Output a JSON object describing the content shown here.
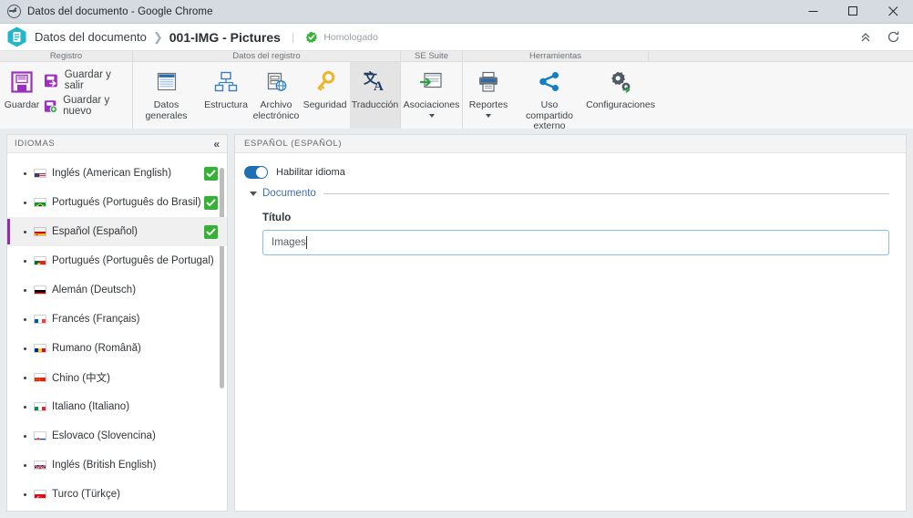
{
  "titlebar": {
    "title": "Datos del documento - Google Chrome",
    "app_icon": "chrome-icon",
    "minimize": "minimize-button",
    "maximize": "maximize-button",
    "close": "close-button"
  },
  "header": {
    "app_icon": "document-hexagon-icon",
    "breadcrumb_root": "Datos del documento",
    "breadcrumb_separator": "❯",
    "breadcrumb_current": "001-IMG - Pictures",
    "divider": "|",
    "status_badge": "Homologado",
    "status_icon": "gear-check-green-icon",
    "collapse_icon": "chevron-double-up-icon",
    "refresh_icon": "refresh-icon"
  },
  "ribbon": {
    "groups": [
      {
        "name": "Registro"
      },
      {
        "name": "Datos del registro"
      },
      {
        "name": "SE Suite"
      },
      {
        "name": "Herramientas"
      }
    ],
    "registro": {
      "save": {
        "label": "Guardar",
        "icon": "floppy-disk-icon"
      },
      "save_exit": {
        "label": "Guardar y salir",
        "icon": "save-exit-icon"
      },
      "save_new": {
        "label": "Guardar y nuevo",
        "icon": "save-new-icon"
      }
    },
    "datos_del_registro": [
      {
        "label": "Datos generales",
        "icon": "window-form-icon",
        "active": false
      },
      {
        "label": "Estructura",
        "icon": "hierarchy-icon",
        "active": false
      },
      {
        "label": "Archivo electrónico",
        "icon": "electronic-file-icon",
        "active": false
      },
      {
        "label": "Seguridad",
        "icon": "key-icon",
        "active": false
      },
      {
        "label": "Traducción",
        "icon": "translate-icon",
        "active": true
      }
    ],
    "se_suite": [
      {
        "label": "Asociaciones",
        "icon": "associations-icon",
        "dropdown": true
      }
    ],
    "herramientas": [
      {
        "label": "Reportes",
        "icon": "printer-icon",
        "dropdown": true
      },
      {
        "label": "Uso compartido externo",
        "icon": "share-icon",
        "dropdown": false
      },
      {
        "label": "Configuraciones",
        "icon": "gears-icon",
        "dropdown": false
      }
    ]
  },
  "sidebar": {
    "title": "IDIOMAS",
    "collapse_icon": "chevron-double-left-icon",
    "items": [
      {
        "label": "Inglés (American English)",
        "flag": "flag-us",
        "checked": true,
        "selected": false
      },
      {
        "label": "Portugués (Português do Brasil)",
        "flag": "flag-br",
        "checked": true,
        "selected": false
      },
      {
        "label": "Español (Español)",
        "flag": "flag-es",
        "checked": true,
        "selected": true
      },
      {
        "label": "Portugués (Português de Portugal)",
        "flag": "flag-pt",
        "checked": false,
        "selected": false
      },
      {
        "label": "Alemán (Deutsch)",
        "flag": "flag-de",
        "checked": false,
        "selected": false
      },
      {
        "label": "Francés (Français)",
        "flag": "flag-fr",
        "checked": false,
        "selected": false
      },
      {
        "label": "Rumano (Română)",
        "flag": "flag-ro",
        "checked": false,
        "selected": false
      },
      {
        "label": "Chino (中文)",
        "flag": "flag-cn",
        "checked": false,
        "selected": false
      },
      {
        "label": "Italiano (Italiano)",
        "flag": "flag-it",
        "checked": false,
        "selected": false
      },
      {
        "label": "Eslovaco (Slovencina)",
        "flag": "flag-sk",
        "checked": false,
        "selected": false
      },
      {
        "label": "Inglés (British English)",
        "flag": "flag-gb",
        "checked": false,
        "selected": false
      },
      {
        "label": "Turco (Türkçe)",
        "flag": "flag-tr",
        "checked": false,
        "selected": false
      }
    ]
  },
  "panel": {
    "title": "ESPAÑOL (ESPAÑOL)",
    "toggle": {
      "label": "Habilitar idioma",
      "on": true
    },
    "section": {
      "title": "Documento",
      "expanded": true
    },
    "field": {
      "label": "Título",
      "value": "Images",
      "placeholder": ""
    }
  },
  "colors": {
    "accent_purple": "#8e2faa",
    "accent_blue": "#1f6fb5",
    "check_green": "#34b233",
    "link_blue": "#3d6ec0",
    "teal": "#1fb6c4"
  }
}
